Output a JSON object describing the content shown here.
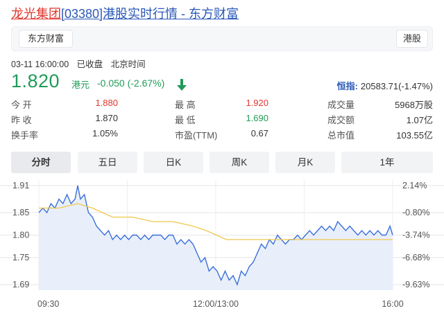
{
  "title": {
    "stock": "龙光集团",
    "rest": "[03380]港股实时行情 - 东方财富"
  },
  "card": {
    "brand_tab": "东方财富",
    "market_tab": "港股"
  },
  "meta": {
    "datetime": "03-11 16:00:00",
    "status": "已收盘",
    "timezone": "北京时间"
  },
  "quote": {
    "price": "1.820",
    "currency": "港元",
    "change": "-0.050 (-2.67%)",
    "price_color": "#1f9b57",
    "direction_icon": "arrow-down-icon"
  },
  "index": {
    "label": "恒指:",
    "value": "20583.71(-1.47%)"
  },
  "stats": [
    {
      "label": "今 开",
      "value": "1.880",
      "color": "red"
    },
    {
      "label": "最 高",
      "value": "1.920",
      "color": "red"
    },
    {
      "label": "成交量",
      "value": "5968万股",
      "color": ""
    },
    {
      "label": "昨 收",
      "value": "1.870",
      "color": ""
    },
    {
      "label": "最 低",
      "value": "1.690",
      "color": "green"
    },
    {
      "label": "成交额",
      "value": "1.07亿",
      "color": ""
    },
    {
      "label": "换手率",
      "value": "1.05%",
      "color": ""
    },
    {
      "label": "市盈(TTM)",
      "value": "0.67",
      "color": ""
    },
    {
      "label": "总市值",
      "value": "103.55亿",
      "color": ""
    }
  ],
  "periods": [
    "分时",
    "五日",
    "日K",
    "周K",
    "月K",
    "1年"
  ],
  "active_period": "分时",
  "chart_data": {
    "type": "line",
    "title": "",
    "xlabel": "",
    "ylabel": "",
    "x_ticks": [
      "09:30",
      "12:00/13:00",
      "16:00"
    ],
    "y_ticks_left": [
      "1.91",
      "1.85",
      "1.80",
      "1.75",
      "1.69"
    ],
    "y_ticks_right": [
      "2.14%",
      "-0.80%",
      "-3.74%",
      "-6.68%",
      "-9.63%"
    ],
    "ylim": [
      1.69,
      1.91
    ],
    "grid": true,
    "series": [
      {
        "color": "#3a6fd8",
        "points": [
          [
            0,
            1.85
          ],
          [
            3,
            1.86
          ],
          [
            6,
            1.85
          ],
          [
            9,
            1.87
          ],
          [
            12,
            1.86
          ],
          [
            15,
            1.88
          ],
          [
            18,
            1.87
          ],
          [
            21,
            1.89
          ],
          [
            24,
            1.87
          ],
          [
            27,
            1.88
          ],
          [
            29,
            1.91
          ],
          [
            31,
            1.88
          ],
          [
            34,
            1.89
          ],
          [
            37,
            1.85
          ],
          [
            40,
            1.84
          ],
          [
            43,
            1.82
          ],
          [
            46,
            1.81
          ],
          [
            49,
            1.8
          ],
          [
            52,
            1.81
          ],
          [
            55,
            1.79
          ],
          [
            58,
            1.8
          ],
          [
            61,
            1.79
          ],
          [
            64,
            1.8
          ],
          [
            67,
            1.79
          ],
          [
            70,
            1.8
          ],
          [
            73,
            1.8
          ],
          [
            76,
            1.79
          ],
          [
            79,
            1.8
          ],
          [
            82,
            1.79
          ],
          [
            85,
            1.8
          ],
          [
            88,
            1.8
          ],
          [
            91,
            1.8
          ],
          [
            94,
            1.79
          ],
          [
            97,
            1.8
          ],
          [
            100,
            1.8
          ],
          [
            103,
            1.78
          ],
          [
            106,
            1.79
          ],
          [
            109,
            1.78
          ],
          [
            112,
            1.79
          ],
          [
            115,
            1.78
          ],
          [
            118,
            1.76
          ],
          [
            121,
            1.74
          ],
          [
            124,
            1.75
          ],
          [
            127,
            1.72
          ],
          [
            130,
            1.73
          ],
          [
            133,
            1.72
          ],
          [
            136,
            1.7
          ],
          [
            139,
            1.72
          ],
          [
            142,
            1.7
          ],
          [
            145,
            1.71
          ],
          [
            148,
            1.69
          ],
          [
            151,
            1.72
          ],
          [
            154,
            1.71
          ],
          [
            157,
            1.73
          ],
          [
            160,
            1.74
          ],
          [
            163,
            1.76
          ],
          [
            166,
            1.78
          ],
          [
            169,
            1.77
          ],
          [
            172,
            1.79
          ],
          [
            175,
            1.78
          ],
          [
            178,
            1.8
          ],
          [
            181,
            1.79
          ],
          [
            184,
            1.78
          ],
          [
            187,
            1.79
          ],
          [
            190,
            1.79
          ],
          [
            193,
            1.8
          ],
          [
            196,
            1.79
          ],
          [
            199,
            1.8
          ],
          [
            202,
            1.81
          ],
          [
            205,
            1.8
          ],
          [
            208,
            1.81
          ],
          [
            211,
            1.82
          ],
          [
            214,
            1.81
          ],
          [
            217,
            1.82
          ],
          [
            220,
            1.81
          ],
          [
            223,
            1.83
          ],
          [
            226,
            1.82
          ],
          [
            229,
            1.81
          ],
          [
            232,
            1.82
          ],
          [
            235,
            1.81
          ],
          [
            238,
            1.8
          ],
          [
            241,
            1.81
          ],
          [
            244,
            1.8
          ],
          [
            247,
            1.81
          ],
          [
            250,
            1.8
          ],
          [
            253,
            1.81
          ],
          [
            256,
            1.8
          ],
          [
            259,
            1.8
          ],
          [
            262,
            1.82
          ],
          [
            264,
            1.8
          ]
        ]
      },
      {
        "color": "#f0c64a",
        "points": [
          [
            0,
            1.86
          ],
          [
            15,
            1.86
          ],
          [
            29,
            1.87
          ],
          [
            40,
            1.86
          ],
          [
            55,
            1.84
          ],
          [
            70,
            1.84
          ],
          [
            85,
            1.83
          ],
          [
            100,
            1.83
          ],
          [
            115,
            1.82
          ],
          [
            125,
            1.81
          ],
          [
            140,
            1.79
          ],
          [
            155,
            1.79
          ],
          [
            170,
            1.79
          ],
          [
            190,
            1.79
          ],
          [
            220,
            1.79
          ],
          [
            250,
            1.79
          ],
          [
            264,
            1.79
          ]
        ]
      }
    ]
  }
}
